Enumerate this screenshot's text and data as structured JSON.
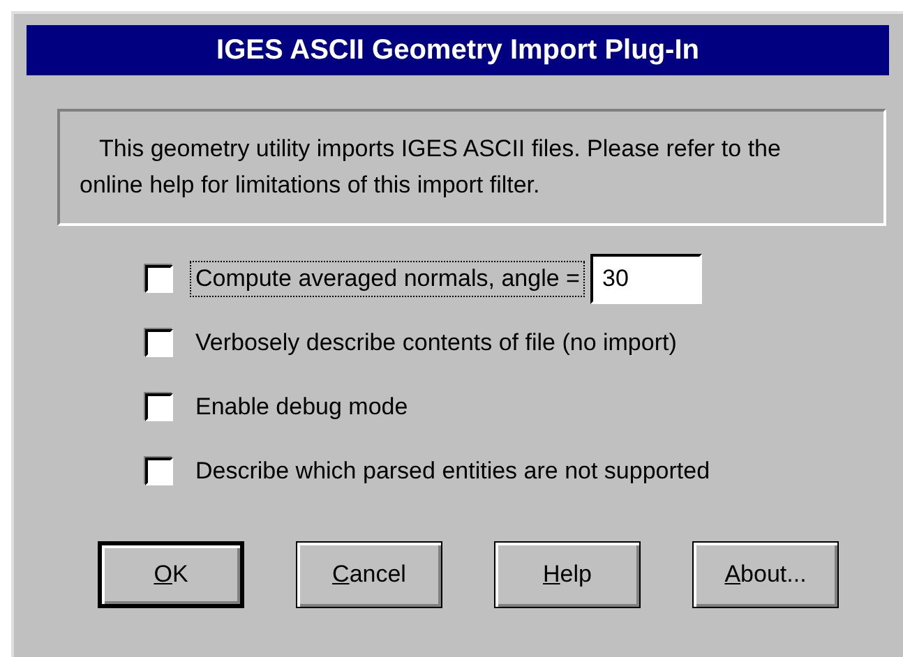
{
  "window": {
    "title": "IGES ASCII Geometry Import Plug-In"
  },
  "description": "This geometry utility imports IGES ASCII files. Please refer to the online help for limitations of this import filter.",
  "options": [
    {
      "label": "Compute averaged normals, angle =",
      "checked": false,
      "focused": true,
      "value": "30"
    },
    {
      "label": "Verbosely describe contents of file (no import)",
      "checked": false,
      "focused": false
    },
    {
      "label": "Enable debug mode",
      "checked": false,
      "focused": false
    },
    {
      "label": "Describe which parsed entities are not supported",
      "checked": false,
      "focused": false
    }
  ],
  "buttons": [
    {
      "label": "OK",
      "default": true,
      "mnemonic_underlined": true
    },
    {
      "label": "Cancel",
      "default": false,
      "mnemonic_underlined": true
    },
    {
      "label": "Help",
      "default": false,
      "mnemonic_underlined": true
    },
    {
      "label": "About...",
      "default": false,
      "mnemonic_underlined": true
    }
  ]
}
